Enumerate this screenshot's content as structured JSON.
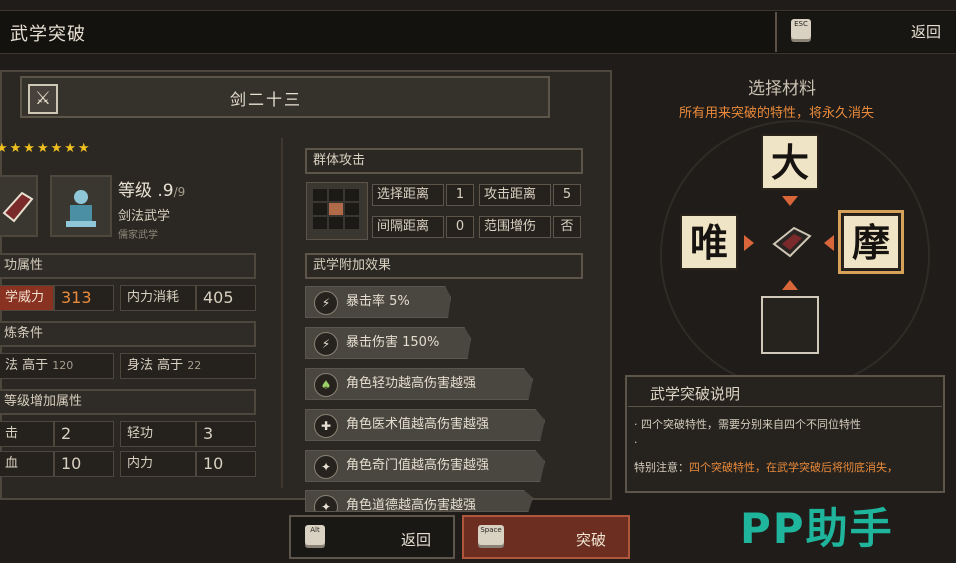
{
  "header": {
    "title": "武学突破",
    "esc_key": "ESC",
    "back_label": "返回"
  },
  "skill": {
    "name": "剑二十三",
    "stars": "★★★★★★★",
    "level_label": "等级",
    "level_value": ".9",
    "level_max": "/9",
    "category": "剑法武学",
    "school": "儒家武学",
    "attr_section": "功属性",
    "power_label": "学威力",
    "power_value": "313",
    "mp_label": "内力消耗",
    "mp_value": "405",
    "cond_section": "炼条件",
    "cond1_label": "法 高于",
    "cond1_value": "120",
    "cond2_label": "身法 高于",
    "cond2_value": "22",
    "bonus_section": "等级增加属性",
    "bonus1_label": "击",
    "bonus1_value": "2",
    "bonus2_label": "轻功",
    "bonus2_value": "3",
    "bonus3_label": "血",
    "bonus3_value": "10",
    "bonus4_label": "内力",
    "bonus4_value": "10"
  },
  "attack": {
    "header": "群体攻击",
    "select_range_label": "选择距离",
    "select_range_value": "1",
    "attack_range_label": "攻击距离",
    "attack_range_value": "5",
    "interval_label": "间隔距离",
    "interval_value": "0",
    "aoe_label": "范围增伤",
    "aoe_value": "否"
  },
  "effects": {
    "header": "武学附加效果",
    "items": [
      {
        "text": "暴击率 5%",
        "icon": "lightning-icon"
      },
      {
        "text": "暴击伤害 150%",
        "icon": "lightning-icon"
      },
      {
        "text": "角色轻功越高伤害越强",
        "icon": "boot-icon"
      },
      {
        "text": "角色医术值越高伤害越强",
        "icon": "medicine-icon"
      },
      {
        "text": "角色奇门值越高伤害越强",
        "icon": "compass-icon"
      },
      {
        "text": "角色道德越高伤害越强",
        "icon": "compass-icon"
      }
    ]
  },
  "materials": {
    "title": "选择材料",
    "subtitle": "所有用来突破的特性，将永久消失",
    "top": "大",
    "left": "唯",
    "right": "摩"
  },
  "explanation": {
    "title": "武学突破说明",
    "line1": "· 四个突破特性，需要分别来自四个不同位特性",
    "line2": "·",
    "line3_prefix": "特别注意：",
    "line3_highlight": "四个突破特性，在武学突破后将彻底消失，"
  },
  "footer": {
    "alt_key": "Alt",
    "back_label": "返回",
    "space_key": "Space",
    "break_label": "突破"
  },
  "watermark": "PP助手",
  "colors": {
    "accent_orange": "#ea8a3a",
    "highlight_red": "#8a3222",
    "star_gold": "#f0c020"
  }
}
